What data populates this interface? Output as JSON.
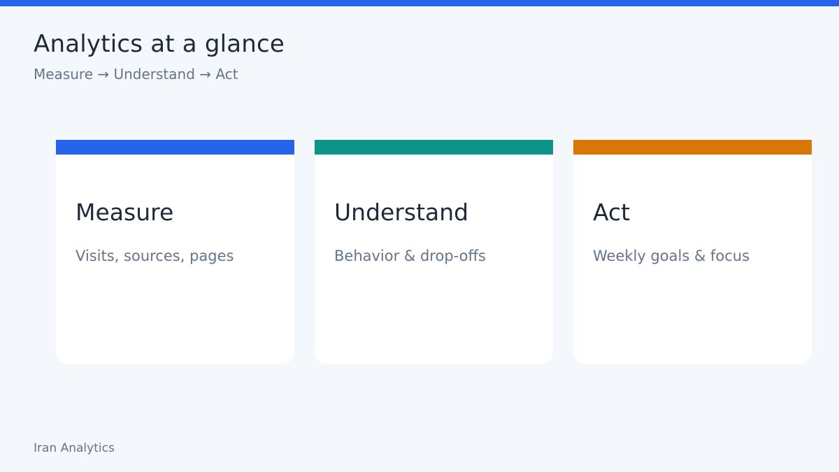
{
  "header": {
    "title": "Analytics at a glance",
    "subtitle": "Measure → Understand → Act"
  },
  "cards": [
    {
      "title": "Measure",
      "text": "Visits, sources, pages",
      "accent": "#2563eb"
    },
    {
      "title": "Understand",
      "text": "Behavior & drop-offs",
      "accent": "#0d9488"
    },
    {
      "title": "Act",
      "text": "Weekly goals & focus",
      "accent": "#d97706"
    }
  ],
  "footer": {
    "label": "Iran Analytics"
  },
  "colors": {
    "top_bar": "#2563eb",
    "background": "#f4f8fd"
  }
}
